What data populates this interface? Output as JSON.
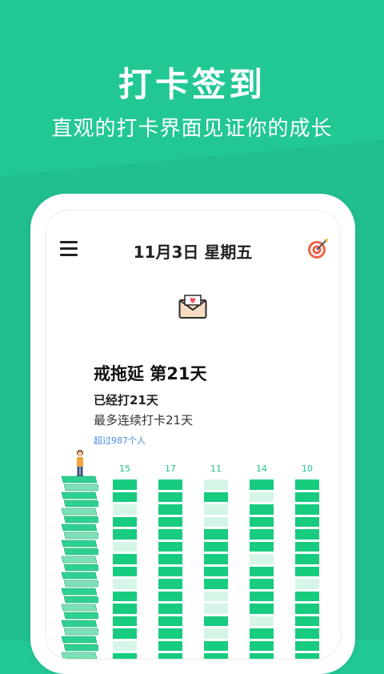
{
  "header": {
    "title": "打卡签到",
    "subtitle": "直观的打卡界面见证你的成长"
  },
  "app": {
    "date": "11月3日  星期五",
    "goal_title": "戒拖延  第21天",
    "done_text": "已经打21天",
    "streak_text": "最多连续打卡21天",
    "surpass_text": "超过987个人",
    "icons": [
      "menu-icon",
      "target-icon",
      "envelope-heart-icon",
      "person-icon"
    ]
  },
  "columns": [
    {
      "label": "15",
      "pattern": [
        1,
        1,
        0,
        1,
        1,
        0,
        1,
        1,
        0,
        1,
        1,
        1,
        1,
        0,
        1
      ]
    },
    {
      "label": "17",
      "pattern": [
        1,
        1,
        1,
        1,
        1,
        1,
        1,
        1,
        1,
        1,
        1,
        1,
        1,
        1,
        1
      ]
    },
    {
      "label": "11",
      "pattern": [
        0,
        1,
        0,
        0,
        1,
        1,
        1,
        1,
        1,
        0,
        0,
        1,
        0,
        1,
        1
      ]
    },
    {
      "label": "14",
      "pattern": [
        1,
        0,
        1,
        1,
        1,
        1,
        0,
        1,
        1,
        1,
        1,
        0,
        1,
        1,
        1
      ]
    },
    {
      "label": "10",
      "pattern": [
        1,
        1,
        1,
        1,
        1,
        1,
        1,
        1,
        0,
        1,
        1,
        1,
        1,
        1,
        1
      ]
    }
  ],
  "colors": {
    "brand_green": "#1fc38b",
    "active_block": "#17cc7f",
    "inactive_block": "#d5f6e7",
    "link_blue": "#4a90e2"
  }
}
